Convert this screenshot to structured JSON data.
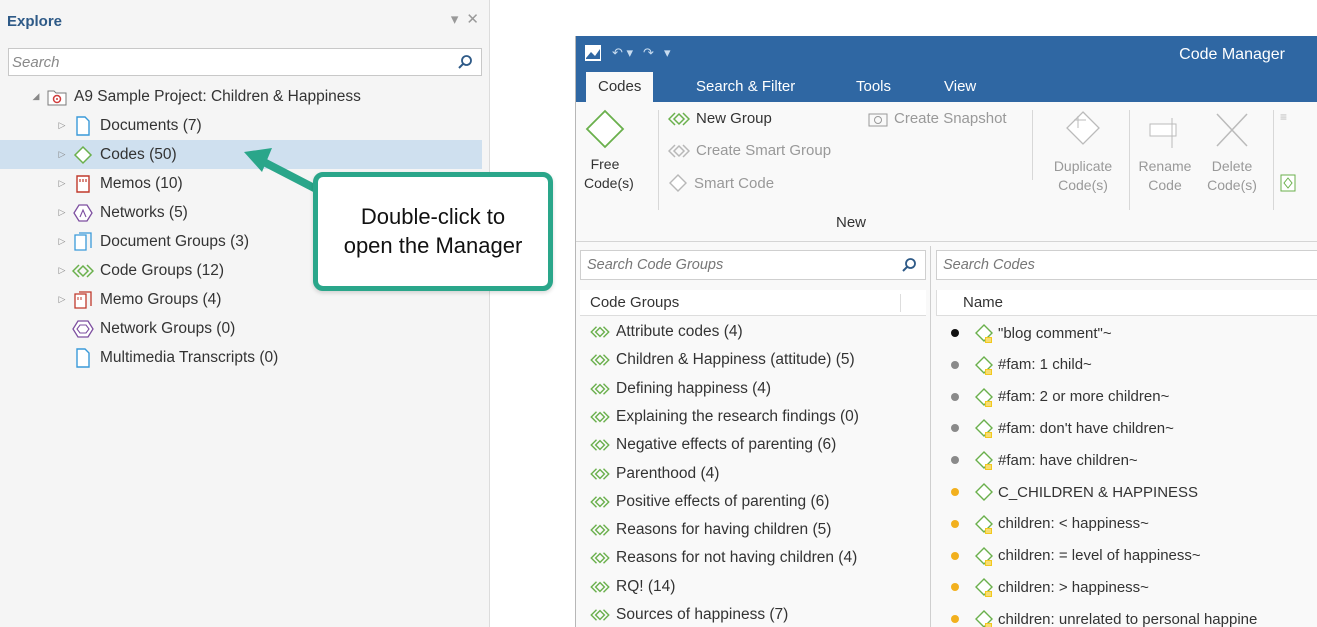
{
  "explore": {
    "title": "Explore",
    "controls": "▾ ✕",
    "search_placeholder": "Search",
    "root": "A9 Sample Project: Children & Happiness",
    "items": [
      {
        "label": "Documents (7)",
        "icon": "document-icon",
        "color": "#3a9ad9"
      },
      {
        "label": "Codes (50)",
        "icon": "code-diamond-icon",
        "color": "#6ab04c"
      },
      {
        "label": "Memos (10)",
        "icon": "memo-icon",
        "color": "#c0392b"
      },
      {
        "label": "Networks (5)",
        "icon": "network-icon",
        "color": "#7d4fa0"
      },
      {
        "label": "Document Groups (3)",
        "icon": "document-group-icon",
        "color": "#3a9ad9"
      },
      {
        "label": "Code Groups (12)",
        "icon": "code-group-icon",
        "color": "#6ab04c"
      },
      {
        "label": "Memo Groups (4)",
        "icon": "memo-group-icon",
        "color": "#c0392b"
      },
      {
        "label": "Network Groups (0)",
        "icon": "network-group-icon",
        "color": "#7d4fa0"
      },
      {
        "label": "Multimedia Transcripts (0)",
        "icon": "transcript-icon",
        "color": "#3a9ad9"
      }
    ]
  },
  "callout": {
    "line1": "Double-click to",
    "line2": "open the Manager",
    "color": "#2aa68a"
  },
  "code_manager": {
    "title": "Code Manager",
    "accent": "#2f67a3",
    "tabs": [
      "Codes",
      "Search & Filter",
      "Tools",
      "View"
    ],
    "ribbon": {
      "free_codes_line1": "Free",
      "free_codes_line2": "Code(s)",
      "new_group": "New Group",
      "create_smart_group": "Create Smart Group",
      "smart_code": "Smart Code",
      "create_snapshot": "Create Snapshot",
      "duplicate_line1": "Duplicate",
      "duplicate_line2": "Code(s)",
      "rename_line1": "Rename",
      "rename_line2": "Code",
      "delete_line1": "Delete",
      "delete_line2": "Code(s)",
      "group_label": "New"
    },
    "groups_pane": {
      "search_placeholder": "Search Code Groups",
      "header": "Code Groups",
      "items": [
        "Attribute codes (4)",
        "Children & Happiness (attitude) (5)",
        "Defining happiness (4)",
        "Explaining the research findings (0)",
        "Negative effects of parenting (6)",
        "Parenthood (4)",
        "Positive effects of parenting (6)",
        "Reasons for having children (5)",
        "Reasons for not having children (4)",
        "RQ! (14)",
        "Sources of happiness (7)"
      ]
    },
    "codes_pane": {
      "search_placeholder": "Search Codes",
      "header": "Name",
      "items": [
        {
          "name": "\"blog comment\"~",
          "dot": "#111111",
          "memo": true
        },
        {
          "name": "#fam: 1 child~",
          "dot": "#8a8a8a",
          "memo": true
        },
        {
          "name": "#fam: 2 or more  children~",
          "dot": "#8a8a8a",
          "memo": true
        },
        {
          "name": "#fam: don't have children~",
          "dot": "#8a8a8a",
          "memo": true
        },
        {
          "name": "#fam: have children~",
          "dot": "#8a8a8a",
          "memo": true
        },
        {
          "name": "C_CHILDREN & HAPPINESS",
          "dot": "#f2b01e",
          "memo": false
        },
        {
          "name": "children: < happiness~",
          "dot": "#f2b01e",
          "memo": true
        },
        {
          "name": "children: = level of happiness~",
          "dot": "#f2b01e",
          "memo": true
        },
        {
          "name": "children: > happiness~",
          "dot": "#f2b01e",
          "memo": true
        },
        {
          "name": "children: unrelated to personal happine",
          "dot": "#f2b01e",
          "memo": true
        }
      ]
    }
  }
}
